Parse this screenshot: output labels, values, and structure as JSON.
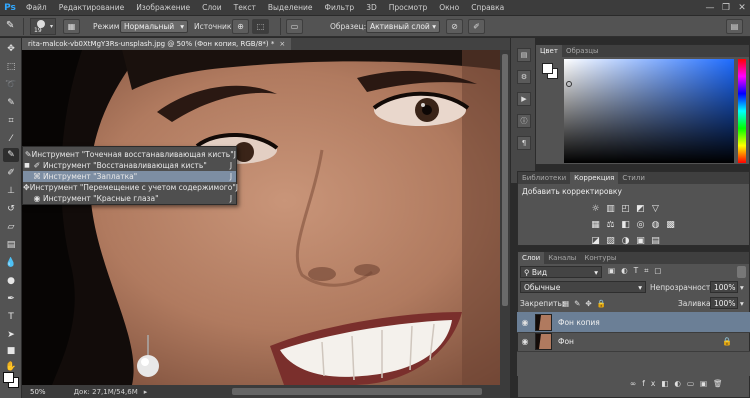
{
  "app": {
    "logo": "Ps"
  },
  "menu": [
    "Файл",
    "Редактирование",
    "Изображение",
    "Слои",
    "Текст",
    "Выделение",
    "Фильтр",
    "3D",
    "Просмотр",
    "Окно",
    "Справка"
  ],
  "window_controls": {
    "minimize": "—",
    "restore": "❐",
    "close": "✕"
  },
  "options": {
    "brush_size": "19",
    "mode_label": "Режим:",
    "mode_value": "Нормальный",
    "source_label": "Источник:",
    "sample_label": "Образец:",
    "sample_value": "Активный слой"
  },
  "document": {
    "tab_title": "rita-malcok-vb0XtMgY3Rs-unsplash.jpg @ 50% (Фон копия, RGB/8*) *",
    "close": "×"
  },
  "status": {
    "zoom": "50%",
    "doc_info": "Док: 27,1M/54,6M"
  },
  "flyout": {
    "items": [
      {
        "label": "Инструмент \"Точечная восстанавливающая кисть\"",
        "key": "J",
        "icon": "spot-healing-brush-icon",
        "selected": false
      },
      {
        "label": "Инструмент \"Восстанавливающая кисть\"",
        "key": "J",
        "icon": "healing-brush-icon",
        "selected": false
      },
      {
        "label": "Инструмент \"Заплатка\"",
        "key": "J",
        "icon": "patch-icon",
        "selected": true
      },
      {
        "label": "Инструмент \"Перемещение с учетом содержимого\"",
        "key": "J",
        "icon": "content-aware-move-icon",
        "selected": false
      },
      {
        "label": "Инструмент \"Красные глаза\"",
        "key": "J",
        "icon": "red-eye-icon",
        "selected": false
      }
    ]
  },
  "color_panel": {
    "tabs": [
      "Цвет",
      "Образцы"
    ]
  },
  "adjustments_panel": {
    "tabs": [
      "Библиотеки",
      "Коррекция",
      "Стили"
    ],
    "title": "Добавить корректировку"
  },
  "layers_panel": {
    "tabs": [
      "Слои",
      "Каналы",
      "Контуры"
    ],
    "filter_label": "Вид",
    "blend_mode": "Обычные",
    "opacity_label": "Непрозрачность:",
    "opacity_value": "100%",
    "lock_label": "Закрепить:",
    "fill_label": "Заливка:",
    "fill_value": "100%",
    "layers": [
      {
        "name": "Фон копия",
        "selected": true,
        "locked": false
      },
      {
        "name": "Фон",
        "selected": false,
        "locked": true
      }
    ]
  },
  "colors": {
    "accent_blue": "#31a8ff",
    "selection": "#7d8ea3",
    "layer_selected": "#6b7f96"
  }
}
